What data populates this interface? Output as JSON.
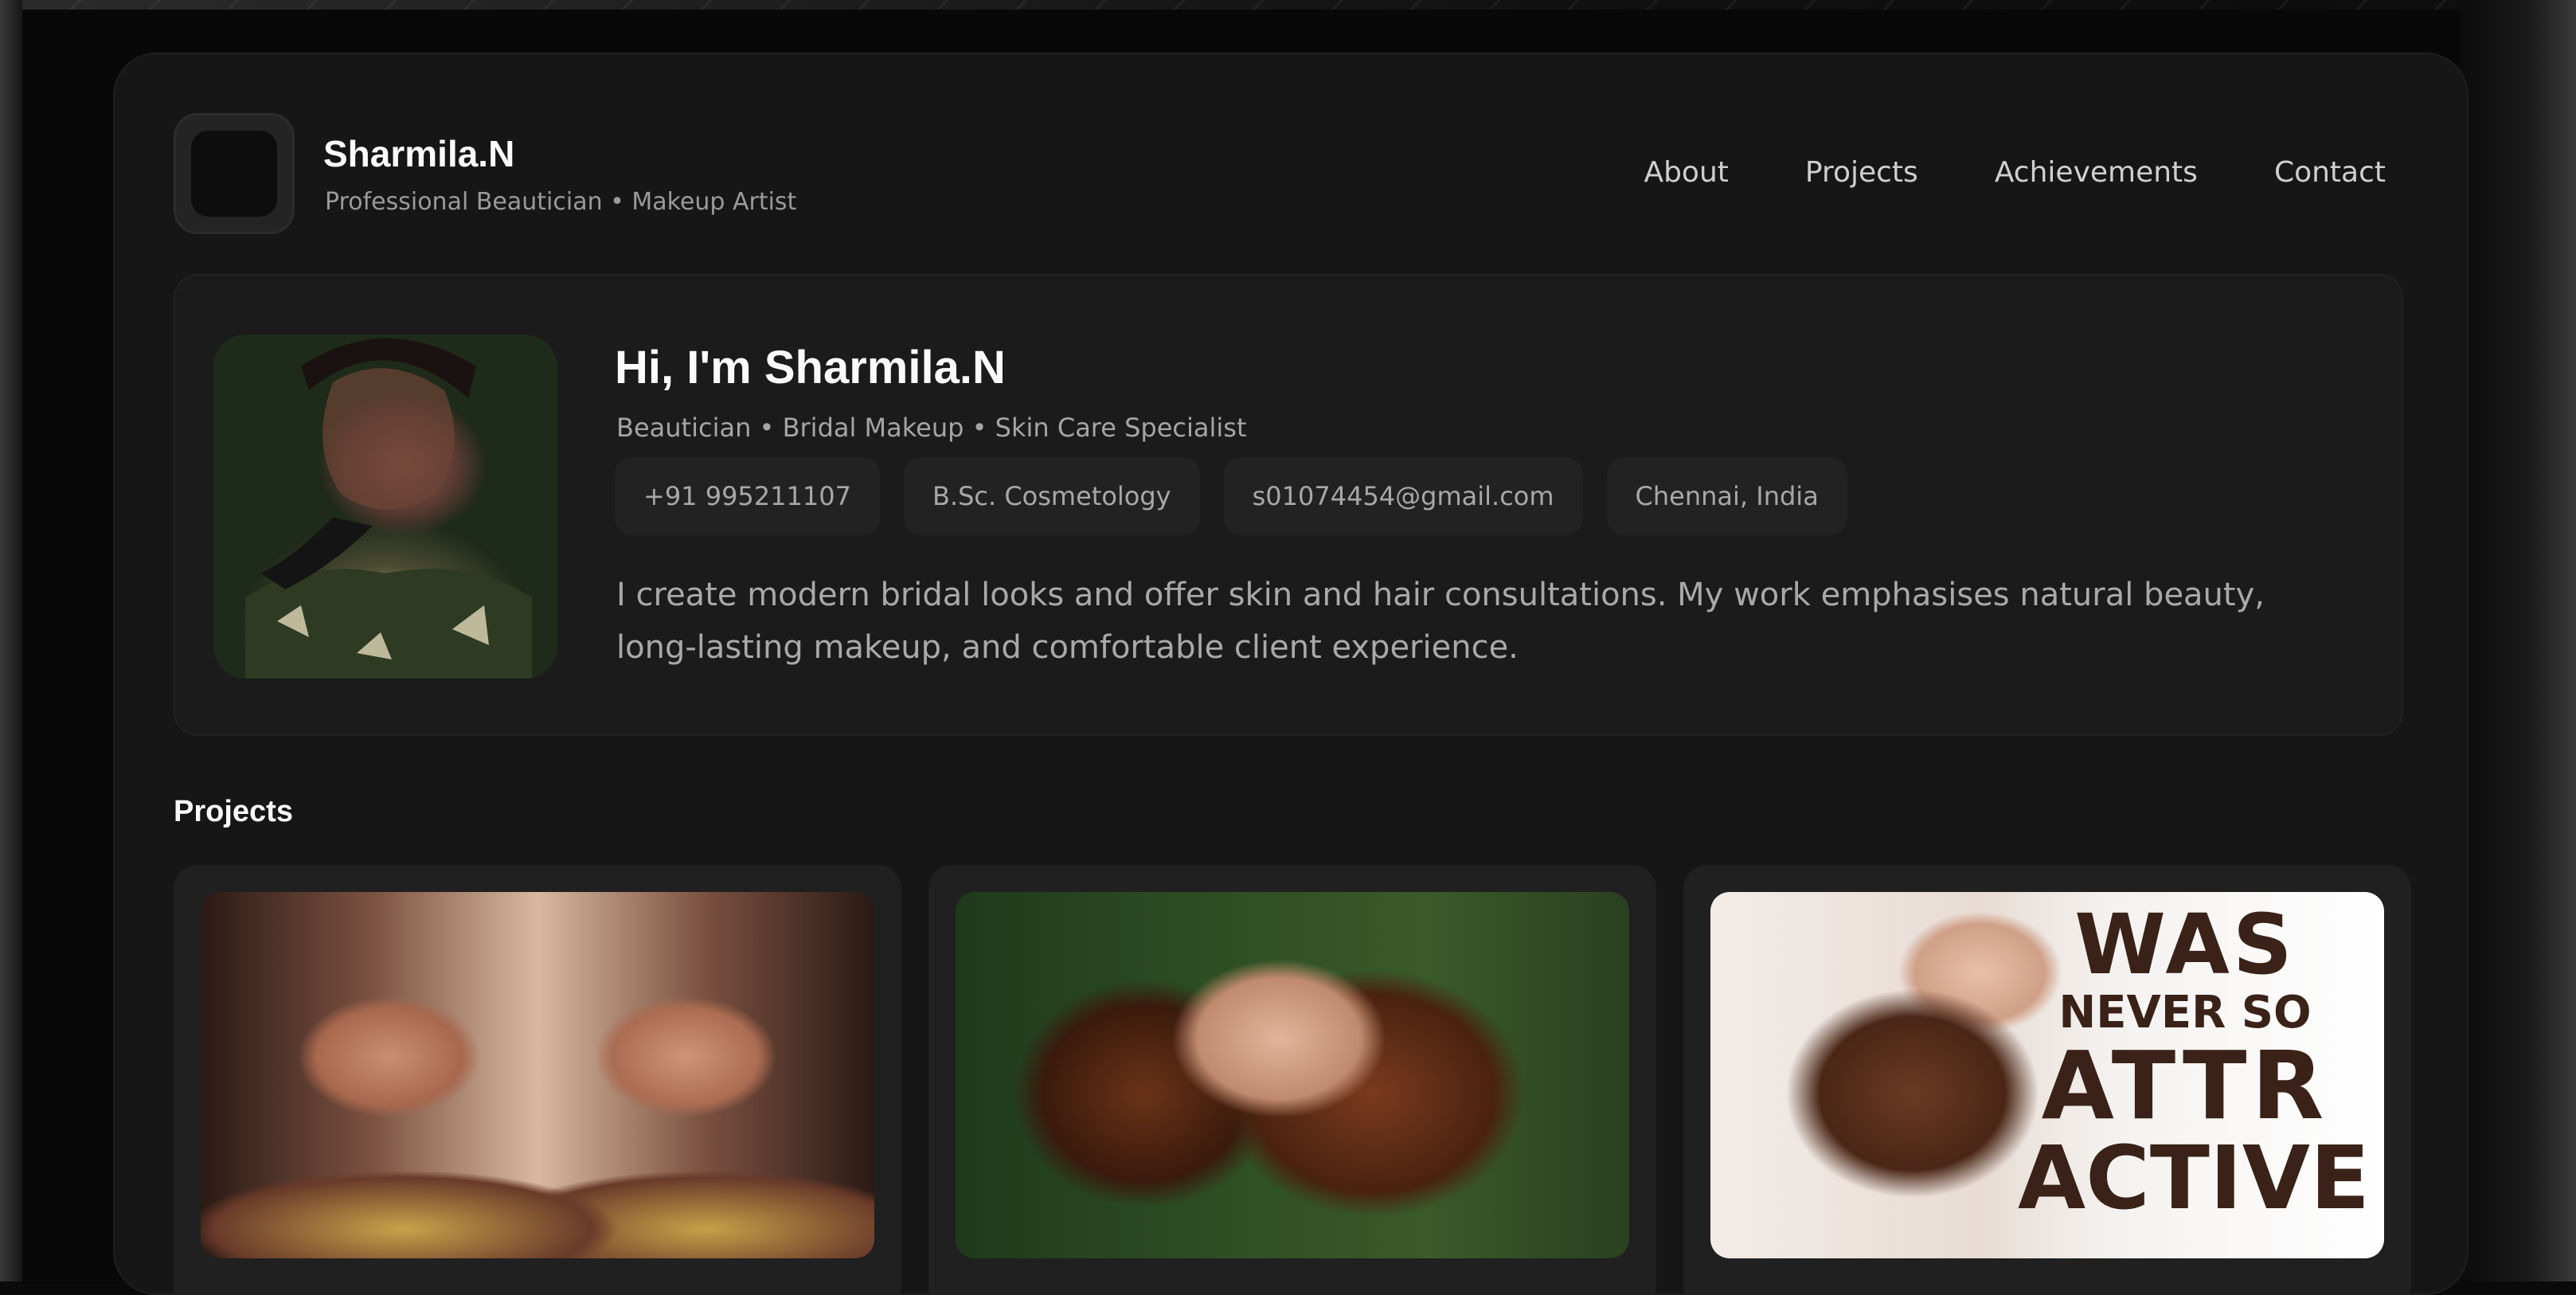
{
  "brand": {
    "name": "Sharmila.N",
    "tagline": "Professional Beautician • Makeup Artist"
  },
  "nav": {
    "items": [
      {
        "label": "About"
      },
      {
        "label": "Projects"
      },
      {
        "label": "Achievements"
      },
      {
        "label": "Contact"
      }
    ]
  },
  "hero": {
    "greeting": "Hi, I'm ",
    "name": "Sharmila.N",
    "subtitle": "Beautician • Bridal Makeup • Skin Care Specialist",
    "chips": [
      {
        "label": "+91 995211107"
      },
      {
        "label": "B.Sc. Cosmetology"
      },
      {
        "label": "s01074454@gmail.com"
      },
      {
        "label": "Chennai, India"
      }
    ],
    "description": "I create modern bridal looks and offer skin and hair consultations. My work emphasises natural beauty, long-lasting makeup, and comfortable client experience."
  },
  "projects": {
    "title": "Projects",
    "poster_lines": [
      "WAS",
      "NEVER SO",
      "ATTR",
      "ACTIVE"
    ]
  }
}
